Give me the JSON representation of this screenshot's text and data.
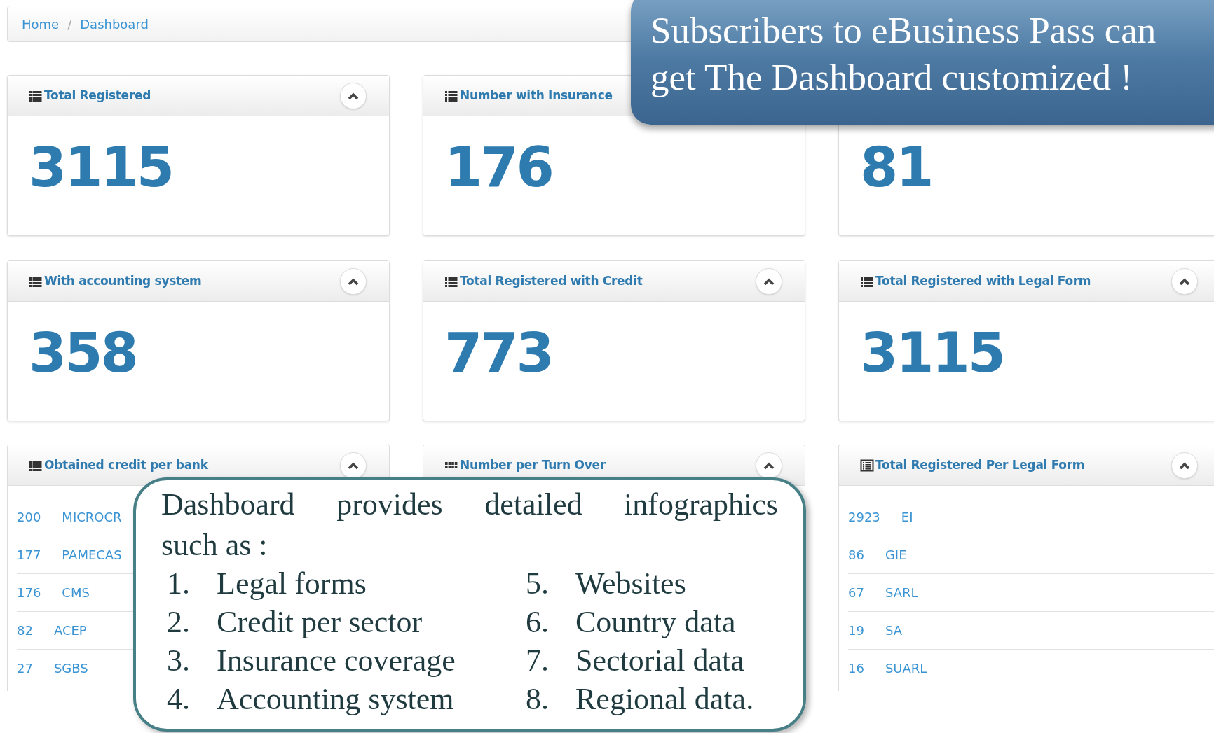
{
  "breadcrumb": {
    "items": [
      {
        "label": "Home"
      },
      {
        "label": "Dashboard"
      }
    ],
    "separator": "/"
  },
  "stat_cards": [
    {
      "title": "Total Registered",
      "value": "3115",
      "collapsible": true
    },
    {
      "title": "Number with Insurance",
      "value": "176"
    },
    {
      "value": "81"
    },
    {
      "title": "With accounting system",
      "value": "358",
      "collapsible": true
    },
    {
      "title": "Total Registered with Credit",
      "value": "773",
      "collapsible": true
    },
    {
      "title": "Total Registered with Legal Form",
      "value": "3115",
      "collapsible": true
    }
  ],
  "list_cards": [
    {
      "title": "Obtained credit per bank",
      "kind": "list",
      "collapsible": true,
      "rows": [
        {
          "count": "200",
          "name": "MICROCR"
        },
        {
          "count": "177",
          "name": "PAMECAS"
        },
        {
          "count": "176",
          "name": "CMS"
        },
        {
          "count": "82",
          "name": "ACEP"
        },
        {
          "count": "27",
          "name": "SGBS"
        }
      ]
    },
    {
      "title": "Number per Turn Over",
      "kind": "grid",
      "collapsible": true
    },
    {
      "title": "Total Registered Per Legal Form",
      "kind": "table",
      "collapsible": true,
      "rows": [
        {
          "count": "2923",
          "name": "EI"
        },
        {
          "count": "86",
          "name": "GIE"
        },
        {
          "count": "67",
          "name": "SARL"
        },
        {
          "count": "19",
          "name": "SA"
        },
        {
          "count": "16",
          "name": "SUARL"
        }
      ]
    }
  ],
  "promo_callout": {
    "lines": [
      "Subscribers to eBusiness Pass can",
      "get The Dashboard customized !"
    ]
  },
  "info_callout": {
    "intro_lines": [
      [
        "Dashboard",
        "provides",
        "detailed",
        "infographics"
      ],
      [
        "such as :"
      ]
    ],
    "items": [
      {
        "number": "1.",
        "label": "Legal forms"
      },
      {
        "number": "2.",
        "label": "Credit per sector"
      },
      {
        "number": "3.",
        "label": "Insurance coverage"
      },
      {
        "number": "4.",
        "label": "Accounting system"
      },
      {
        "number": "5.",
        "label": "Websites"
      },
      {
        "number": "6.",
        "label": "Country data"
      },
      {
        "number": "7.",
        "label": "Sectorial data"
      },
      {
        "number": "8.",
        "label": "Regional data."
      }
    ]
  }
}
